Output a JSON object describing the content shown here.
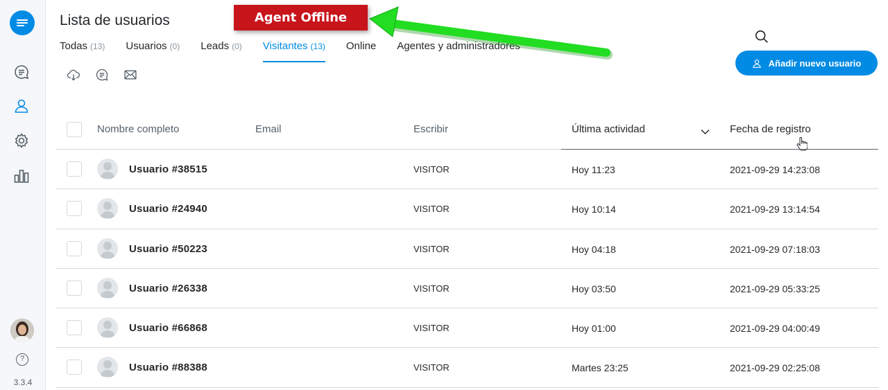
{
  "app": {
    "version": "3.3.4",
    "help_glyph": "?"
  },
  "header": {
    "title": "Lista de usuarios",
    "tabs": [
      {
        "label": "Todas",
        "count": "(13)",
        "active": false
      },
      {
        "label": "Usuarios",
        "count": "(0)",
        "active": false
      },
      {
        "label": "Leads",
        "count": "(0)",
        "active": false
      },
      {
        "label": "Visitantes",
        "count": "(13)",
        "active": true
      },
      {
        "label": "Online",
        "count": "",
        "active": false
      },
      {
        "label": "Agentes y administradores",
        "count": "",
        "active": false
      }
    ],
    "add_user_label": "Añadir nuevo usuario"
  },
  "annotation": {
    "label": "Agent Offline",
    "box_color": "#c8141b",
    "arrow_color": "#22dd22"
  },
  "table": {
    "columns": {
      "name": "Nombre completo",
      "email": "Email",
      "type": "Escribir",
      "last_activity": "Última actividad",
      "created": "Fecha de registro"
    },
    "rows": [
      {
        "name": "Usuario #38515",
        "email": "",
        "type": "VISITOR",
        "last": "Hoy 11:23",
        "created": "2021-09-29 14:23:08"
      },
      {
        "name": "Usuario #24940",
        "email": "",
        "type": "VISITOR",
        "last": "Hoy 10:14",
        "created": "2021-09-29 13:14:54"
      },
      {
        "name": "Usuario #50223",
        "email": "",
        "type": "VISITOR",
        "last": "Hoy 04:18",
        "created": "2021-09-29 07:18:03"
      },
      {
        "name": "Usuario #26338",
        "email": "",
        "type": "VISITOR",
        "last": "Hoy 03:50",
        "created": "2021-09-29 05:33:25"
      },
      {
        "name": "Usuario #66868",
        "email": "",
        "type": "VISITOR",
        "last": "Hoy 01:00",
        "created": "2021-09-29 04:00:49"
      },
      {
        "name": "Usuario #88388",
        "email": "",
        "type": "VISITOR",
        "last": "Martes 23:25",
        "created": "2021-09-29 02:25:08"
      }
    ]
  },
  "colors": {
    "accent": "#028be5",
    "text": "#24272a",
    "muted": "#566069",
    "border": "#d4d8dc"
  }
}
